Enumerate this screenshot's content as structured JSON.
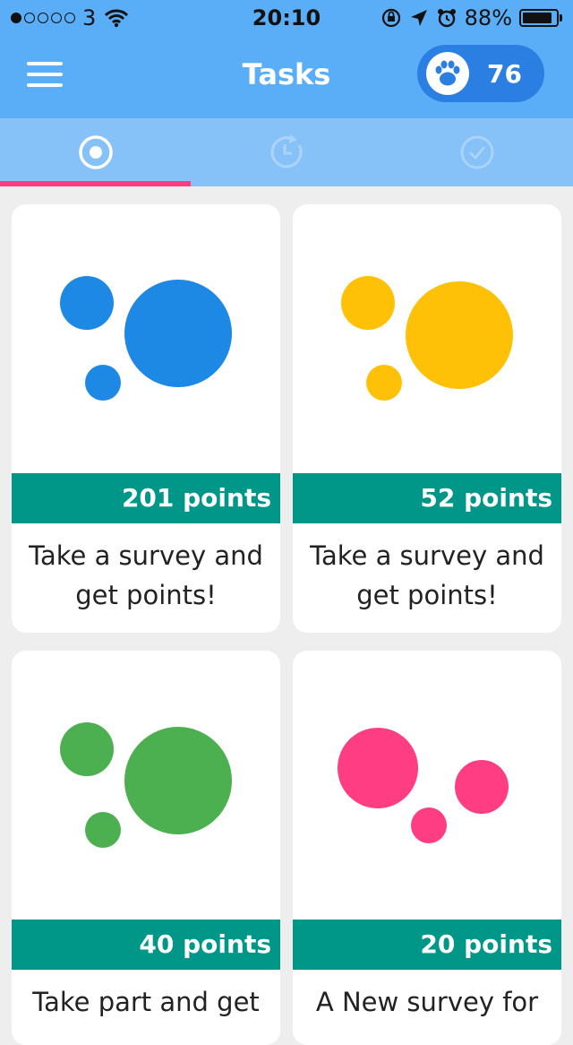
{
  "status_bar": {
    "carrier": "3",
    "time": "20:10",
    "battery": "88%",
    "signal_bars": 1,
    "battery_level": 0.88
  },
  "app_bar": {
    "title": "Tasks",
    "points": "76",
    "menu_icon": "hamburger-menu-icon",
    "points_icon": "paw-icon"
  },
  "tabs": [
    {
      "icon": "radio-target-icon",
      "selected": true
    },
    {
      "icon": "clock-refresh-icon",
      "selected": false
    },
    {
      "icon": "check-circle-icon",
      "selected": false
    }
  ],
  "cards": [
    {
      "points": "201 points",
      "text_line1": "Take a survey and",
      "text_line2": "get points!",
      "color": "#1e88e5"
    },
    {
      "points": "52 points",
      "text_line1": "Take a survey and",
      "text_line2": "get points!",
      "color": "#ffc107"
    },
    {
      "points": "40 points",
      "text_line1": "Take part and get",
      "text_line2": "",
      "color": "#4caf50"
    },
    {
      "points": "20 points",
      "text_line1": "A New survey for",
      "text_line2": "",
      "color": "#ff3d83"
    }
  ],
  "colors": {
    "header": "#5aaef7",
    "tabs": "#86c2f7",
    "accent": "#ff3d83",
    "points_bar": "#009688"
  }
}
